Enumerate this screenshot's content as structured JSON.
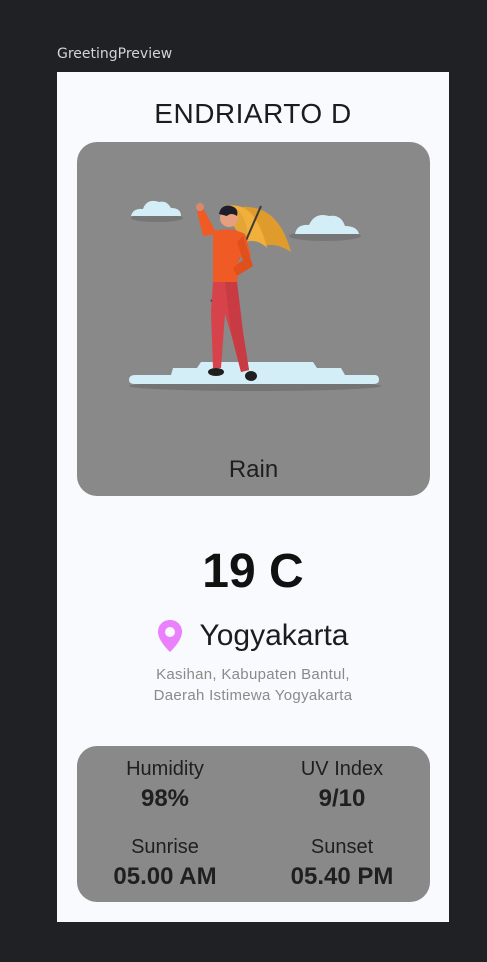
{
  "preview": {
    "label": "GreetingPreview"
  },
  "header": {
    "name": "ENDRIARTO D"
  },
  "weather": {
    "condition": "Rain",
    "temperature": "19 C",
    "illustration_icon": "person-with-umbrella-illustration"
  },
  "location": {
    "icon": "location-pin-icon",
    "city": "Yogyakarta",
    "address_line1": "Kasihan, Kabupaten Bantul,",
    "address_line2": "Daerah Istimewa Yogyakarta"
  },
  "stats": {
    "humidity": {
      "label": "Humidity",
      "value": "98%"
    },
    "uv_index": {
      "label": "UV Index",
      "value": "9/10"
    },
    "sunrise": {
      "label": "Sunrise",
      "value": "05.00 AM"
    },
    "sunset": {
      "label": "Sunset",
      "value": "05.40 PM"
    }
  },
  "colors": {
    "background": "#202124",
    "screen": "#f9fafd",
    "card": "#898989",
    "pin": "#ea80fc"
  }
}
